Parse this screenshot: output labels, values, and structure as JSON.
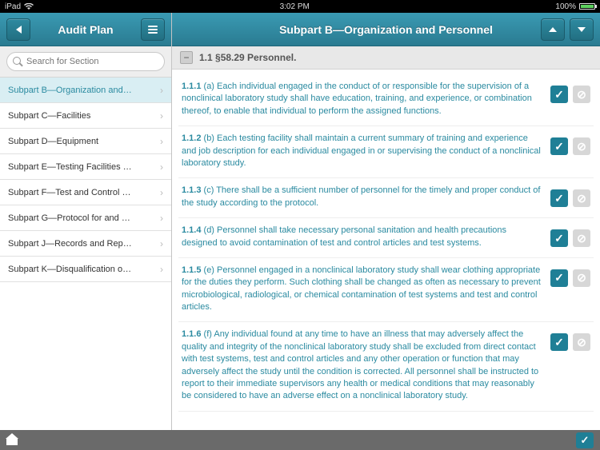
{
  "status": {
    "device": "iPad",
    "time": "3:02 PM",
    "battery": "100%"
  },
  "sidebar": {
    "title": "Audit Plan",
    "search_placeholder": "Search for Section",
    "items": [
      {
        "label": "Subpart B—Organization and…",
        "selected": true
      },
      {
        "label": "Subpart C—Facilities",
        "selected": false
      },
      {
        "label": "Subpart D—Equipment",
        "selected": false
      },
      {
        "label": "Subpart E—Testing Facilities …",
        "selected": false
      },
      {
        "label": "Subpart F—Test and Control …",
        "selected": false
      },
      {
        "label": "Subpart G—Protocol for and …",
        "selected": false
      },
      {
        "label": "Subpart J—Records and Rep…",
        "selected": false
      },
      {
        "label": "Subpart K—Disqualification o…",
        "selected": false
      }
    ]
  },
  "main": {
    "title": "Subpart B—Organization and Personnel",
    "section_title": "1.1 §58.29 Personnel.",
    "items": [
      {
        "num": "1.1.1",
        "text": "(a) Each individual engaged in the conduct of or responsible for the supervision of a nonclinical laboratory study shall have education, training, and experience, or combination thereof, to enable that individual to perform the assigned functions."
      },
      {
        "num": "1.1.2",
        "text": "(b) Each testing facility shall maintain a current summary of training and experience and job description for each individual engaged in or supervising the conduct of a nonclinical laboratory study."
      },
      {
        "num": "1.1.3",
        "text": "(c) There shall be a sufficient number of personnel for the timely and proper conduct of the study according to the protocol."
      },
      {
        "num": "1.1.4",
        "text": "(d) Personnel shall take necessary personal sanitation and health precautions designed to avoid contamination of test and control articles and test systems."
      },
      {
        "num": "1.1.5",
        "text": "(e) Personnel engaged in a nonclinical laboratory study shall wear clothing appropriate for the duties they perform. Such clothing shall be changed as often as necessary to prevent microbiological, radiological, or chemical contamination of test systems and test and control articles."
      },
      {
        "num": "1.1.6",
        "text": "(f) Any individual found at any time to have an illness that may adversely affect the quality and integrity of the nonclinical laboratory study shall be excluded from direct contact with test systems, test and control articles and any other operation or function that may adversely affect the study until the condition is corrected. All personnel shall be instructed to report to their immediate supervisors any health or medical conditions that may reasonably be considered to have an adverse effect on a nonclinical laboratory study."
      }
    ]
  }
}
